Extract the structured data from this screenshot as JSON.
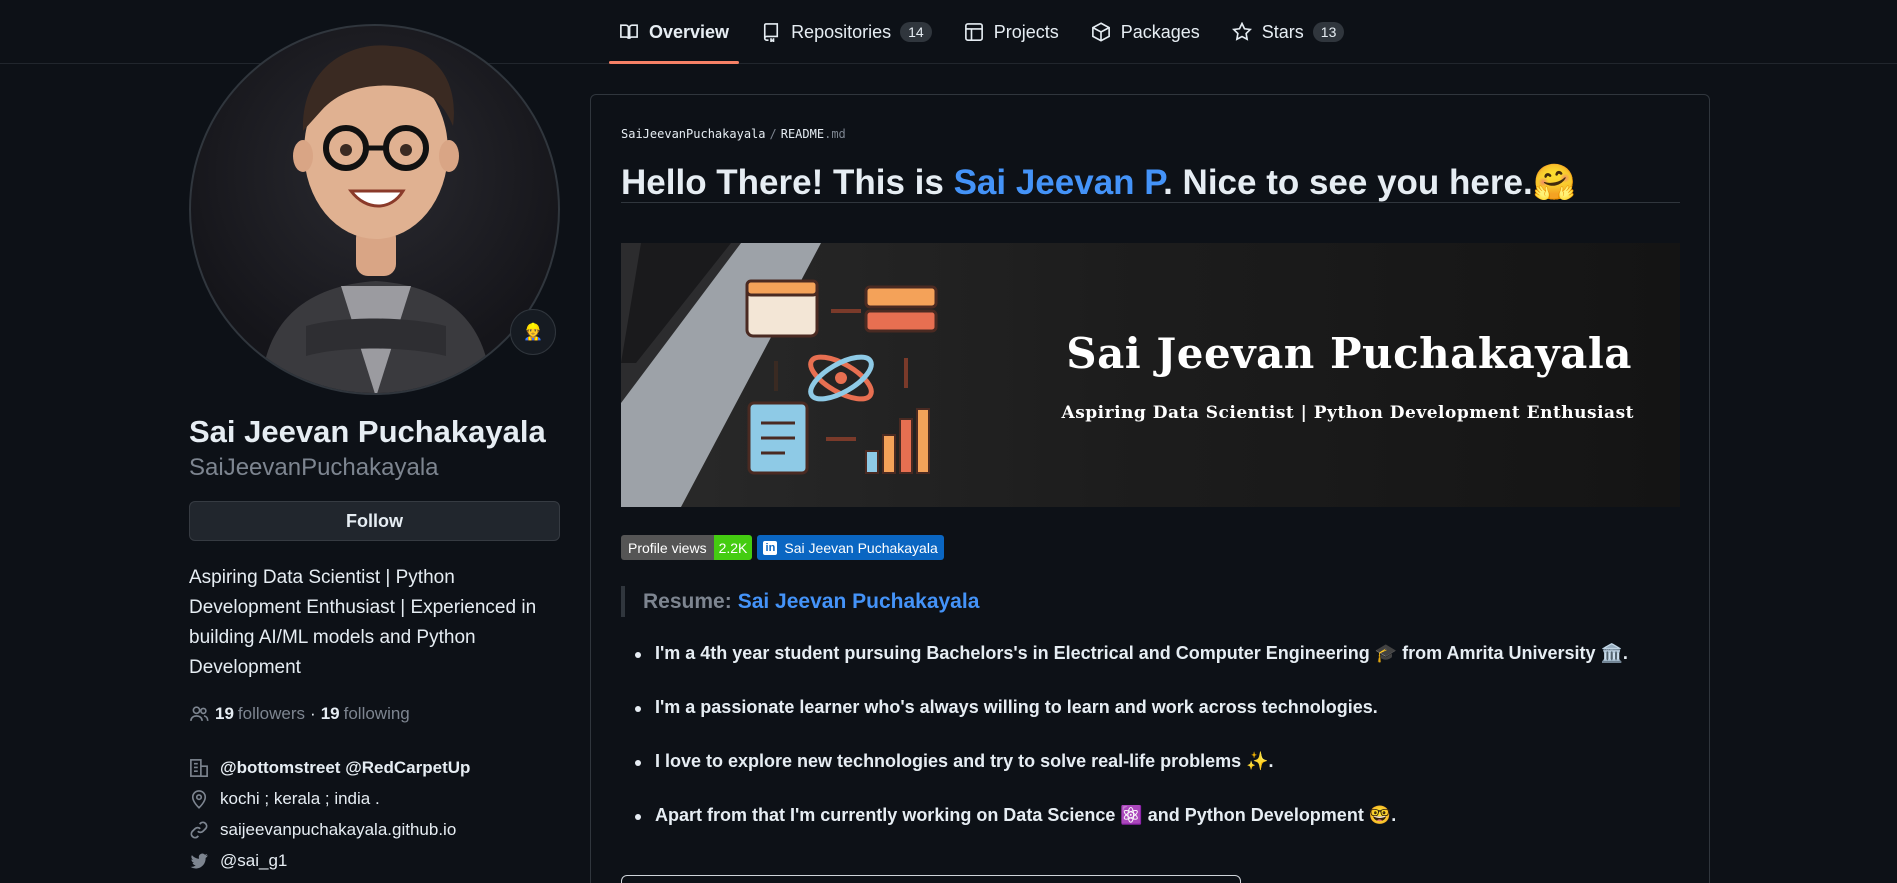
{
  "nav": {
    "tabs": [
      {
        "label": "Overview",
        "icon": "book-icon",
        "active": true
      },
      {
        "label": "Repositories",
        "icon": "repo-icon",
        "count": "14"
      },
      {
        "label": "Projects",
        "icon": "table-icon"
      },
      {
        "label": "Packages",
        "icon": "package-icon"
      },
      {
        "label": "Stars",
        "icon": "star-icon",
        "count": "13"
      }
    ]
  },
  "profile": {
    "name": "Sai Jeevan Puchakayala",
    "login": "SaiJeevanPuchakayala",
    "follow_label": "Follow",
    "bio": "Aspiring Data Scientist | Python Development Enthusiast | Experienced in building AI/ML models and Python Development",
    "followers_count": "19",
    "followers_label": "followers",
    "following_count": "19",
    "following_label": "following",
    "separator": "·",
    "organizations": "@bottomstreet @RedCarpetUp",
    "location": "kochi ; kerala ; india .",
    "website": "saijeevanpuchakayala.github.io",
    "twitter": "@sai_g1"
  },
  "readme": {
    "breadcrumb_owner": "SaiJeevanPuchakayala",
    "breadcrumb_sep": "/",
    "breadcrumb_file": "README",
    "breadcrumb_ext": ".md",
    "heading_prefix": "Hello There! This is ",
    "heading_link": "Sai Jeevan P",
    "heading_suffix": ". Nice to see you here.",
    "heading_emoji": "🤗",
    "banner_title": "Sai Jeevan Puchakayala",
    "banner_subtitle": "Aspiring Data Scientist | Python Development Enthusiast",
    "badge_views_label": "Profile views",
    "badge_views_value": "2.2K",
    "badge_linkedin_label": "Sai Jeevan Puchakayala",
    "badge_linkedin_icon": "in",
    "resume_label": "Resume:",
    "resume_link": "Sai Jeevan Puchakayala",
    "items": [
      "I'm a 4th year student pursuing Bachelors's in Electrical and Computer Engineering 🎓 from Amrita University 🏛️.",
      "I'm a passionate learner who's always willing to learn and work across technologies.",
      "I love to explore new technologies and try to solve real-life problems ✨.",
      "Apart from that I'm currently working on Data Science ⚛️ and Python Development 🤓."
    ]
  },
  "colors": {
    "background": "#0d1117",
    "accent_link": "#4493f8",
    "tab_underline": "#f78166",
    "badge_green": "#44cc11",
    "linkedin_blue": "#0a66c2"
  }
}
